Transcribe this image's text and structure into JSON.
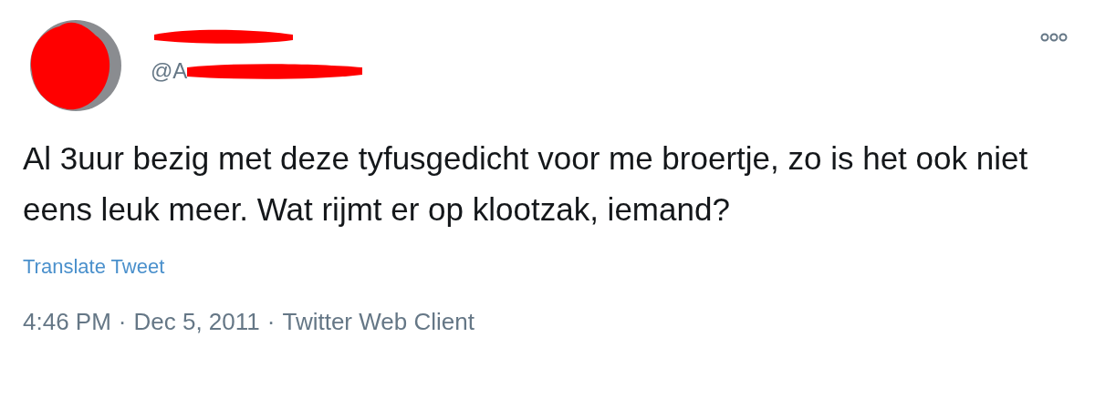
{
  "author": {
    "handle": "@A"
  },
  "tweet": {
    "text": "Al 3uur bezig met deze tyfusgedicht voor me broertje, zo is het ook niet eens leuk meer. Wat rijmt er op klootzak, iemand?"
  },
  "translate_link": "Translate Tweet",
  "meta": {
    "time": "4:46 PM",
    "date": "Dec 5, 2011",
    "source": "Twitter Web Client",
    "separator": "·"
  }
}
